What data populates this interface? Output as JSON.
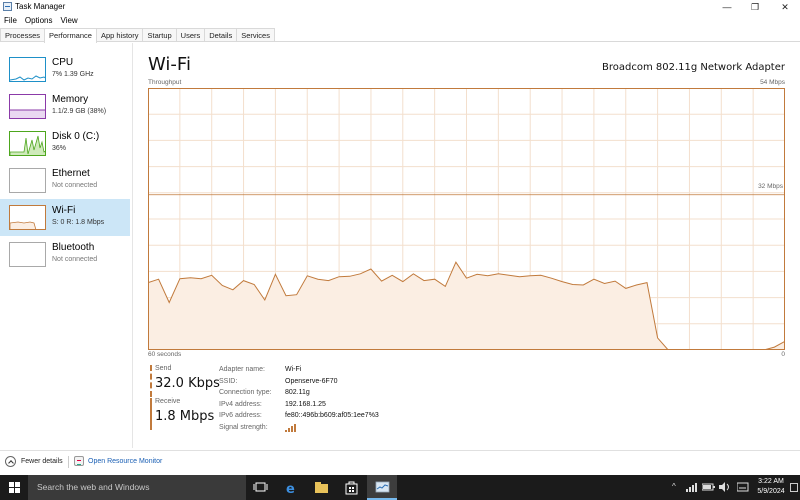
{
  "window": {
    "title": "Task Manager",
    "minimize_glyph": "—",
    "maximize_glyph": "❐",
    "close_glyph": "✕"
  },
  "menu": [
    "File",
    "Options",
    "View"
  ],
  "tabs": [
    "Processes",
    "Performance",
    "App history",
    "Startup",
    "Users",
    "Details",
    "Services"
  ],
  "active_tab": "Performance",
  "sidebar": {
    "items": [
      {
        "name": "CPU",
        "detail": "7%  1.39 GHz",
        "color": "#1e90c8",
        "selected": false
      },
      {
        "name": "Memory",
        "detail": "1.1/2.9 GB (38%)",
        "color": "#8b3aa8",
        "selected": false
      },
      {
        "name": "Disk 0 (C:)",
        "detail": "36%",
        "color": "#4da61d",
        "selected": false
      },
      {
        "name": "Ethernet",
        "detail": "Not connected",
        "color": "#a9a9a9",
        "selected": false
      },
      {
        "name": "Wi-Fi",
        "detail": "S: 0 R: 1.8 Mbps",
        "color": "#c17a3c",
        "selected": true
      },
      {
        "name": "Bluetooth",
        "detail": "Not connected",
        "color": "#a9a9a9",
        "selected": false
      }
    ]
  },
  "main": {
    "title": "Wi-Fi",
    "adapter": "Broadcom 802.11g Network Adapter",
    "throughput_label": "Throughput",
    "max_label": "54 Mbps",
    "gridline_label": "32 Mbps",
    "x_left": "60 seconds",
    "x_right": "0"
  },
  "chart_data": {
    "type": "area",
    "title": "Throughput",
    "xlabel": "",
    "ylabel": "",
    "x_range_seconds": [
      60,
      0
    ],
    "ylim_mbps": [
      0,
      54
    ],
    "grid": true,
    "color": "#c17a3c",
    "fill": "#fbeee3",
    "series": [
      {
        "values_mbps": [
          13.9,
          14.6,
          9.8,
          14.7,
          14.9,
          14.7,
          15.4,
          13.3,
          12.4,
          14.3,
          13.5,
          10.3,
          15.6,
          11.2,
          11.4,
          15.3,
          14.6,
          14.3,
          15.1,
          15.2,
          15.7,
          16.7,
          14.2,
          15.4,
          14.1,
          15.7,
          14.3,
          14.6,
          13.1,
          18.1,
          14.8,
          15.6,
          15.3,
          15.7,
          15.4,
          15.1,
          15.3,
          15.4,
          14.8,
          14.1,
          13.5,
          13.4,
          14.6,
          13.7,
          14.2,
          12.7,
          13.4,
          13.9,
          2.5,
          0,
          0,
          0,
          0,
          0,
          0,
          0,
          0,
          0,
          0,
          0.6,
          1.8
        ]
      }
    ]
  },
  "stats": {
    "send_label": "Send",
    "send_value": "32.0 Kbps",
    "receive_label": "Receive",
    "receive_value": "1.8 Mbps"
  },
  "properties": [
    {
      "key": "Adapter name:",
      "value": "Wi-Fi"
    },
    {
      "key": "SSID:",
      "value": "Openserve-6F70"
    },
    {
      "key": "Connection type:",
      "value": "802.11g"
    },
    {
      "key": "IPv4 address:",
      "value": "192.168.1.25"
    },
    {
      "key": "IPv6 address:",
      "value": "fe80::496b:b609:af05:1ee7%3"
    },
    {
      "key": "Signal strength:",
      "value": ""
    }
  ],
  "signal_strength_bars": 4,
  "footer": {
    "fewer_details": "Fewer details",
    "open_resource_monitor": "Open Resource Monitor"
  },
  "taskbar": {
    "search_placeholder": "Search the web and Windows",
    "time": "3:22 AM",
    "date": "5/9/2024",
    "tray_chevron": "^"
  },
  "icons": [
    "task-manager-icon",
    "chevron-up-icon",
    "resource-monitor-icon",
    "windows-start-icon",
    "task-view-icon",
    "edge-icon",
    "file-explorer-icon",
    "store-icon",
    "task-manager-taskbar-icon",
    "wifi-tray-icon",
    "volume-tray-icon",
    "battery-tray-icon",
    "notification-icon"
  ]
}
